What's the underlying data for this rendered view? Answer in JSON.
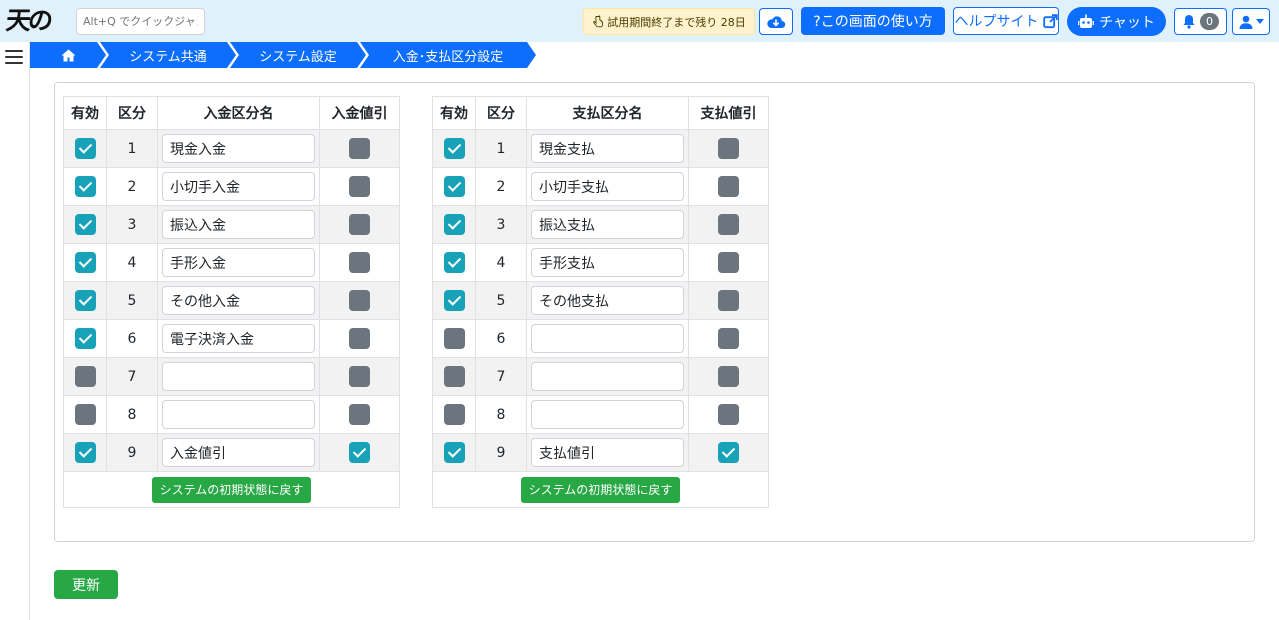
{
  "header": {
    "logo_text": "天の蔵",
    "quickjump_placeholder": "Alt+Q でクイックジャンプ",
    "trial_text": "試用期間終了まで残り 28日",
    "help_button": "?この画面の使い方",
    "help_site": "ヘルプサイト",
    "chat_label": "チャット",
    "notification_count": "0"
  },
  "breadcrumb": {
    "items": [
      "システム共通",
      "システム設定",
      "入金･支払区分設定"
    ]
  },
  "deposit_table": {
    "headers": [
      "有効",
      "区分",
      "入金区分名",
      "入金値引"
    ],
    "rows": [
      {
        "valid": true,
        "no": "1",
        "name": "現金入金",
        "discount": false
      },
      {
        "valid": true,
        "no": "2",
        "name": "小切手入金",
        "discount": false
      },
      {
        "valid": true,
        "no": "3",
        "name": "振込入金",
        "discount": false
      },
      {
        "valid": true,
        "no": "4",
        "name": "手形入金",
        "discount": false
      },
      {
        "valid": true,
        "no": "5",
        "name": "その他入金",
        "discount": false
      },
      {
        "valid": true,
        "no": "6",
        "name": "電子決済入金",
        "discount": false
      },
      {
        "valid": false,
        "no": "7",
        "name": "",
        "discount": false
      },
      {
        "valid": false,
        "no": "8",
        "name": "",
        "discount": false
      },
      {
        "valid": true,
        "no": "9",
        "name": "入金値引",
        "discount": true
      }
    ],
    "reset_label": "システムの初期状態に戻す"
  },
  "payment_table": {
    "headers": [
      "有効",
      "区分",
      "支払区分名",
      "支払値引"
    ],
    "rows": [
      {
        "valid": true,
        "no": "1",
        "name": "現金支払",
        "discount": false
      },
      {
        "valid": true,
        "no": "2",
        "name": "小切手支払",
        "discount": false
      },
      {
        "valid": true,
        "no": "3",
        "name": "振込支払",
        "discount": false
      },
      {
        "valid": true,
        "no": "4",
        "name": "手形支払",
        "discount": false
      },
      {
        "valid": true,
        "no": "5",
        "name": "その他支払",
        "discount": false
      },
      {
        "valid": false,
        "no": "6",
        "name": "",
        "discount": false
      },
      {
        "valid": false,
        "no": "7",
        "name": "",
        "discount": false
      },
      {
        "valid": false,
        "no": "8",
        "name": "",
        "discount": false
      },
      {
        "valid": true,
        "no": "9",
        "name": "支払値引",
        "discount": true
      }
    ],
    "reset_label": "システムの初期状態に戻す"
  },
  "footer": {
    "update_label": "更新"
  },
  "colors": {
    "primary": "#0d6efd",
    "success": "#28a745",
    "checkbox_on": "#17a2b8",
    "checkbox_off": "#6c757d",
    "header_bg": "#e1f1fb"
  }
}
